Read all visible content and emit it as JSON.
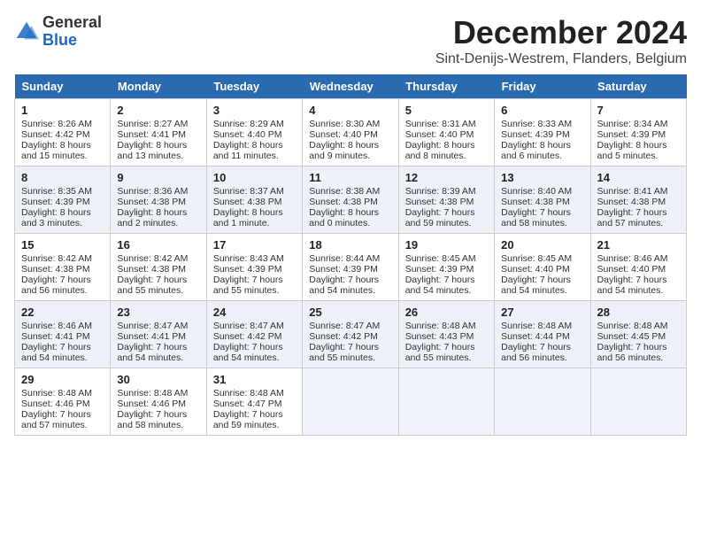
{
  "header": {
    "logo_general": "General",
    "logo_blue": "Blue",
    "month_year": "December 2024",
    "location": "Sint-Denijs-Westrem, Flanders, Belgium"
  },
  "days_of_week": [
    "Sunday",
    "Monday",
    "Tuesday",
    "Wednesday",
    "Thursday",
    "Friday",
    "Saturday"
  ],
  "weeks": [
    [
      {
        "day": "1",
        "sunrise": "8:26 AM",
        "sunset": "4:42 PM",
        "daylight": "8 hours and 15 minutes."
      },
      {
        "day": "2",
        "sunrise": "8:27 AM",
        "sunset": "4:41 PM",
        "daylight": "8 hours and 13 minutes."
      },
      {
        "day": "3",
        "sunrise": "8:29 AM",
        "sunset": "4:40 PM",
        "daylight": "8 hours and 11 minutes."
      },
      {
        "day": "4",
        "sunrise": "8:30 AM",
        "sunset": "4:40 PM",
        "daylight": "8 hours and 9 minutes."
      },
      {
        "day": "5",
        "sunrise": "8:31 AM",
        "sunset": "4:40 PM",
        "daylight": "8 hours and 8 minutes."
      },
      {
        "day": "6",
        "sunrise": "8:33 AM",
        "sunset": "4:39 PM",
        "daylight": "8 hours and 6 minutes."
      },
      {
        "day": "7",
        "sunrise": "8:34 AM",
        "sunset": "4:39 PM",
        "daylight": "8 hours and 5 minutes."
      }
    ],
    [
      {
        "day": "8",
        "sunrise": "8:35 AM",
        "sunset": "4:39 PM",
        "daylight": "8 hours and 3 minutes."
      },
      {
        "day": "9",
        "sunrise": "8:36 AM",
        "sunset": "4:38 PM",
        "daylight": "8 hours and 2 minutes."
      },
      {
        "day": "10",
        "sunrise": "8:37 AM",
        "sunset": "4:38 PM",
        "daylight": "8 hours and 1 minute."
      },
      {
        "day": "11",
        "sunrise": "8:38 AM",
        "sunset": "4:38 PM",
        "daylight": "8 hours and 0 minutes."
      },
      {
        "day": "12",
        "sunrise": "8:39 AM",
        "sunset": "4:38 PM",
        "daylight": "7 hours and 59 minutes."
      },
      {
        "day": "13",
        "sunrise": "8:40 AM",
        "sunset": "4:38 PM",
        "daylight": "7 hours and 58 minutes."
      },
      {
        "day": "14",
        "sunrise": "8:41 AM",
        "sunset": "4:38 PM",
        "daylight": "7 hours and 57 minutes."
      }
    ],
    [
      {
        "day": "15",
        "sunrise": "8:42 AM",
        "sunset": "4:38 PM",
        "daylight": "7 hours and 56 minutes."
      },
      {
        "day": "16",
        "sunrise": "8:42 AM",
        "sunset": "4:38 PM",
        "daylight": "7 hours and 55 minutes."
      },
      {
        "day": "17",
        "sunrise": "8:43 AM",
        "sunset": "4:39 PM",
        "daylight": "7 hours and 55 minutes."
      },
      {
        "day": "18",
        "sunrise": "8:44 AM",
        "sunset": "4:39 PM",
        "daylight": "7 hours and 54 minutes."
      },
      {
        "day": "19",
        "sunrise": "8:45 AM",
        "sunset": "4:39 PM",
        "daylight": "7 hours and 54 minutes."
      },
      {
        "day": "20",
        "sunrise": "8:45 AM",
        "sunset": "4:40 PM",
        "daylight": "7 hours and 54 minutes."
      },
      {
        "day": "21",
        "sunrise": "8:46 AM",
        "sunset": "4:40 PM",
        "daylight": "7 hours and 54 minutes."
      }
    ],
    [
      {
        "day": "22",
        "sunrise": "8:46 AM",
        "sunset": "4:41 PM",
        "daylight": "7 hours and 54 minutes."
      },
      {
        "day": "23",
        "sunrise": "8:47 AM",
        "sunset": "4:41 PM",
        "daylight": "7 hours and 54 minutes."
      },
      {
        "day": "24",
        "sunrise": "8:47 AM",
        "sunset": "4:42 PM",
        "daylight": "7 hours and 54 minutes."
      },
      {
        "day": "25",
        "sunrise": "8:47 AM",
        "sunset": "4:42 PM",
        "daylight": "7 hours and 55 minutes."
      },
      {
        "day": "26",
        "sunrise": "8:48 AM",
        "sunset": "4:43 PM",
        "daylight": "7 hours and 55 minutes."
      },
      {
        "day": "27",
        "sunrise": "8:48 AM",
        "sunset": "4:44 PM",
        "daylight": "7 hours and 56 minutes."
      },
      {
        "day": "28",
        "sunrise": "8:48 AM",
        "sunset": "4:45 PM",
        "daylight": "7 hours and 56 minutes."
      }
    ],
    [
      {
        "day": "29",
        "sunrise": "8:48 AM",
        "sunset": "4:46 PM",
        "daylight": "7 hours and 57 minutes."
      },
      {
        "day": "30",
        "sunrise": "8:48 AM",
        "sunset": "4:46 PM",
        "daylight": "7 hours and 58 minutes."
      },
      {
        "day": "31",
        "sunrise": "8:48 AM",
        "sunset": "4:47 PM",
        "daylight": "7 hours and 59 minutes."
      },
      null,
      null,
      null,
      null
    ]
  ]
}
